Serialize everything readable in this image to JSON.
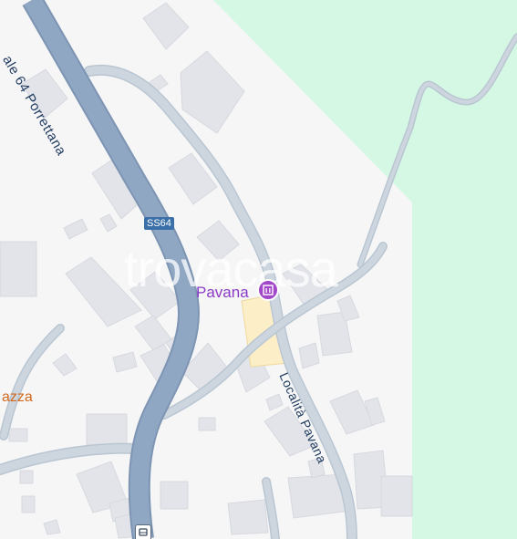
{
  "map": {
    "labels": {
      "highway_name": "ale 64 Porrettana",
      "highway_shield": "SS64",
      "local_road": "Località Pavana",
      "poi_name": "Pavana",
      "place_fragment": "azza",
      "watermark": "trovacasa"
    },
    "icons": {
      "poi": "museum-icon",
      "transit": "bus-stop-icon"
    },
    "colors": {
      "background": "#f6f6f7",
      "park": "#d5f8e4",
      "building": "#e2e4e9",
      "highway": "#8fa7c3",
      "local_road": "#c7d2dc",
      "poi_area": "#fcefc8",
      "poi_icon": "#a347c9",
      "poi_label": "#8b3ac7"
    }
  }
}
